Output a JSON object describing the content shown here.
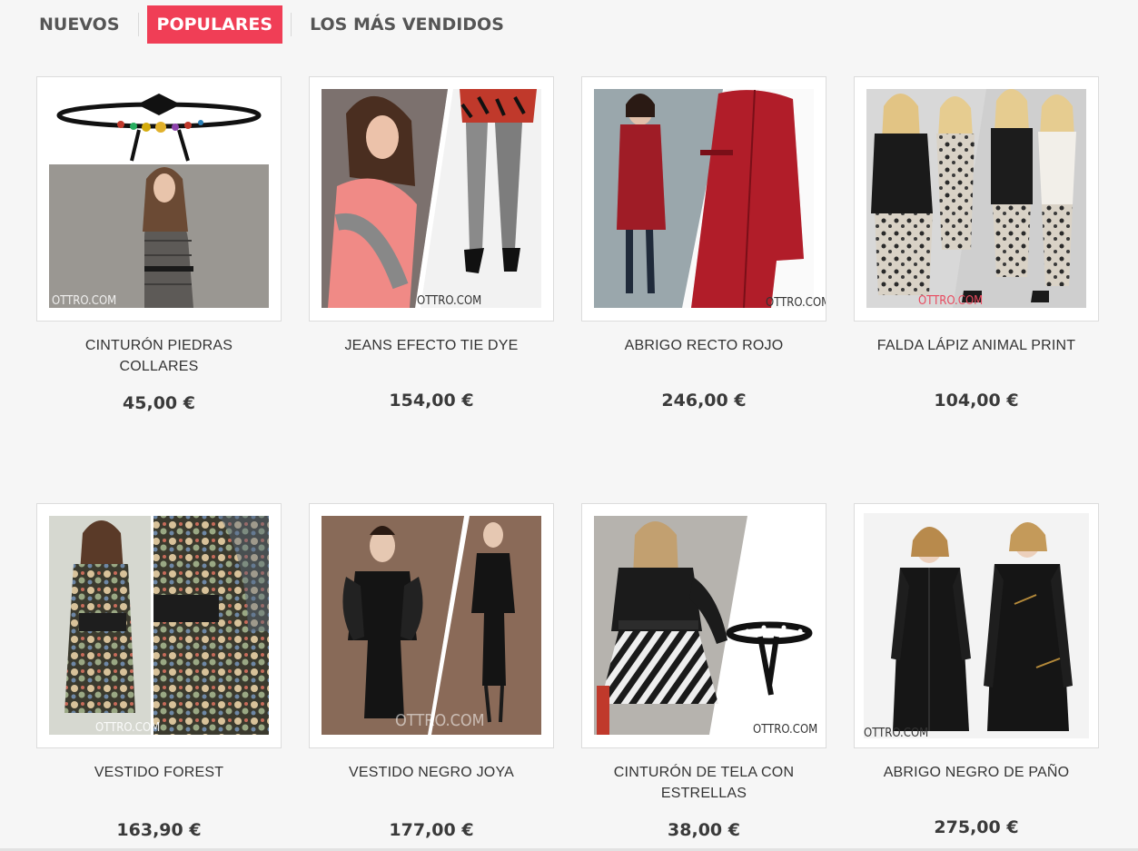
{
  "tabs": [
    {
      "label": "NUEVOS",
      "active": false
    },
    {
      "label": "POPULARES",
      "active": true
    },
    {
      "label": "LOS MÁS VENDIDOS",
      "active": false
    }
  ],
  "watermark": "OTTRO.COM",
  "products": [
    {
      "name": "CINTURÓN PIEDRAS COLLARES",
      "price": "45,00 €"
    },
    {
      "name": "JEANS EFECTO TIE DYE",
      "price": "154,00 €"
    },
    {
      "name": "ABRIGO RECTO ROJO",
      "price": "246,00 €"
    },
    {
      "name": "FALDA LÁPIZ ANIMAL PRINT",
      "price": "104,00 €"
    },
    {
      "name": "VESTIDO FOREST",
      "price": "163,90 €"
    },
    {
      "name": "VESTIDO NEGRO JOYA",
      "price": "177,00 €"
    },
    {
      "name": "CINTURÓN DE TELA CON ESTRELLAS",
      "price": "38,00 €"
    },
    {
      "name": "ABRIGO NEGRO DE PAÑO",
      "price": "275,00 €"
    }
  ],
  "colors": {
    "accent": "#f03e56",
    "background": "#f6f6f6",
    "text": "#333333"
  }
}
